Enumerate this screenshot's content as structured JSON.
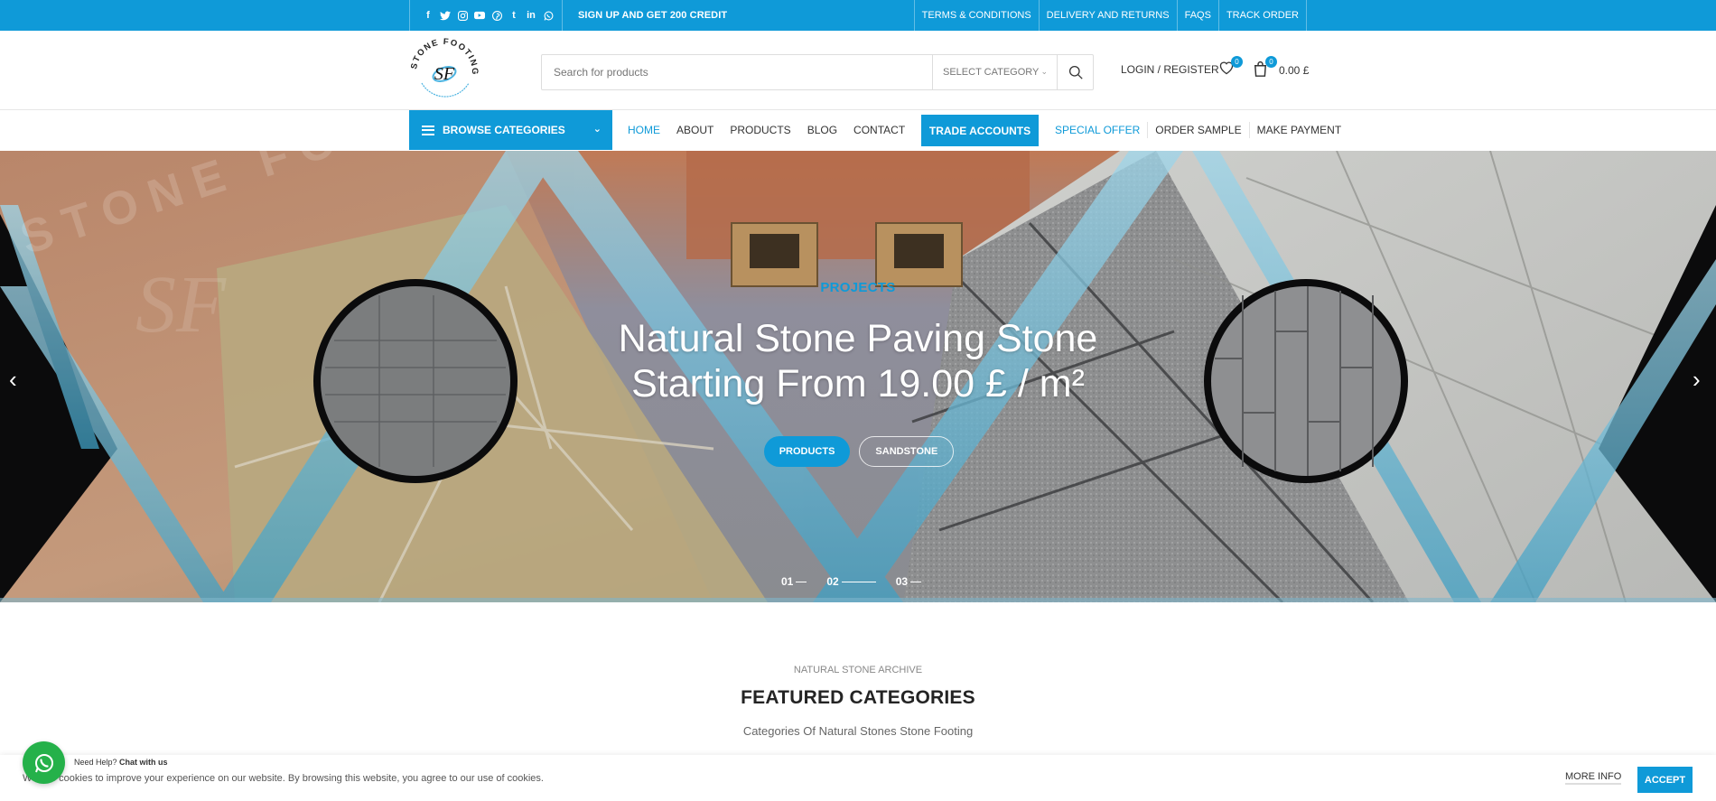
{
  "topbar": {
    "social_icons": [
      "facebook-icon",
      "twitter-icon",
      "instagram-icon",
      "youtube-icon",
      "pinterest-icon",
      "tumblr-icon",
      "linkedin-icon",
      "whatsapp-icon"
    ],
    "signup": "SIGN UP AND GET 200 CREDIT",
    "links": [
      "TERMS & CONDITIONS",
      "DELIVERY AND RETURNS",
      "FAQS",
      "TRACK ORDER"
    ]
  },
  "header": {
    "logo_text": "STONE FOOTING",
    "logo_mark": "SF",
    "search_placeholder": "Search for products",
    "category_select": "SELECT CATEGORY",
    "login": "LOGIN / REGISTER",
    "wishlist_count": "0",
    "cart_count": "0",
    "cart_total": "0.00 £"
  },
  "nav": {
    "browse": "BROWSE CATEGORIES",
    "menu": [
      "HOME",
      "ABOUT",
      "PRODUCTS",
      "BLOG",
      "CONTACT"
    ],
    "trade": "TRADE ACCOUNTS",
    "right_menu": [
      "SPECIAL OFFER",
      "ORDER SAMPLE",
      "MAKE PAYMENT"
    ]
  },
  "hero": {
    "subtitle": "PROJECTS",
    "title_line1": "Natural Stone Paving Stone",
    "title_line2": "Starting From 19.00 £ / m²",
    "btn_primary": "PRODUCTS",
    "btn_secondary": "SANDSTONE",
    "dots": [
      "01",
      "02",
      "03"
    ],
    "watermark": "STONE FOOTING"
  },
  "featured": {
    "subtitle": "NATURAL STONE ARCHIVE",
    "title": "FEATURED CATEGORIES",
    "description": "Categories Of Natural Stones Stone Footing"
  },
  "cookie": {
    "text": "We use cookies to improve your experience on our website. By browsing this website, you agree to our use of cookies.",
    "more": "MORE INFO",
    "accept": "ACCEPT"
  },
  "whatsapp": {
    "prefix": "Need Help?",
    "cta": "Chat with us"
  },
  "colors": {
    "brand": "#0f9ad8",
    "whatsapp": "#25b14a"
  }
}
